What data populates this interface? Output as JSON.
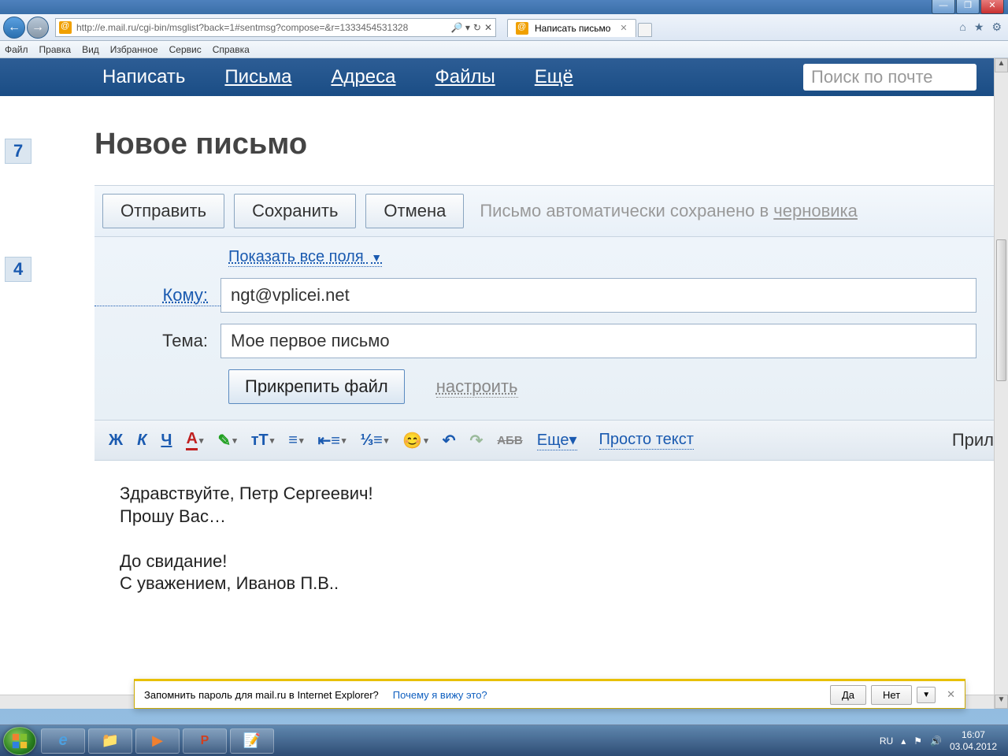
{
  "browser": {
    "url": "http://e.mail.ru/cgi-bin/msglist?back=1#sentmsg?compose=&r=1333454531328",
    "tab_title": "Написать письмо",
    "menu": {
      "file": "Файл",
      "edit": "Правка",
      "view": "Вид",
      "favorites": "Избранное",
      "service": "Сервис",
      "help": "Справка"
    }
  },
  "mailnav": {
    "compose": "Написать",
    "letters": "Письма",
    "addresses": "Адреса",
    "files": "Файлы",
    "more": "Ещё",
    "search_placeholder": "Поиск по почте"
  },
  "leftnums": {
    "a": "7",
    "b": "4"
  },
  "compose": {
    "title": "Новое письмо",
    "send": "Отправить",
    "save": "Сохранить",
    "cancel": "Отмена",
    "autosave_prefix": "Письмо автоматически сохранено в ",
    "autosave_link": "черновика",
    "show_all": "Показать все поля",
    "to_label": "Кому:",
    "to_value": "ngt@vplicei.net",
    "subject_label": "Тема:",
    "subject_value": "Мое первое письмо",
    "attach": "Прикрепить файл",
    "configure": "настроить"
  },
  "editor": {
    "bold": "Ж",
    "italic": "К",
    "underline": "Ч",
    "strikeglyph": "АБВ",
    "more": "Еще",
    "plain": "Просто текст",
    "right": "Прил",
    "body_line1": "Здравствуйте, Петр Сергеевич!",
    "body_line2": "Прошу Вас…",
    "body_line3": "До свидание!",
    "body_line4": "С уважением, Иванов П.В.."
  },
  "notif": {
    "text": "Запомнить пароль для mail.ru в Internet Explorer?",
    "why": "Почему я вижу это?",
    "yes": "Да",
    "no": "Нет"
  },
  "tray": {
    "lang": "RU",
    "time": "16:07",
    "date": "03.04.2012"
  }
}
